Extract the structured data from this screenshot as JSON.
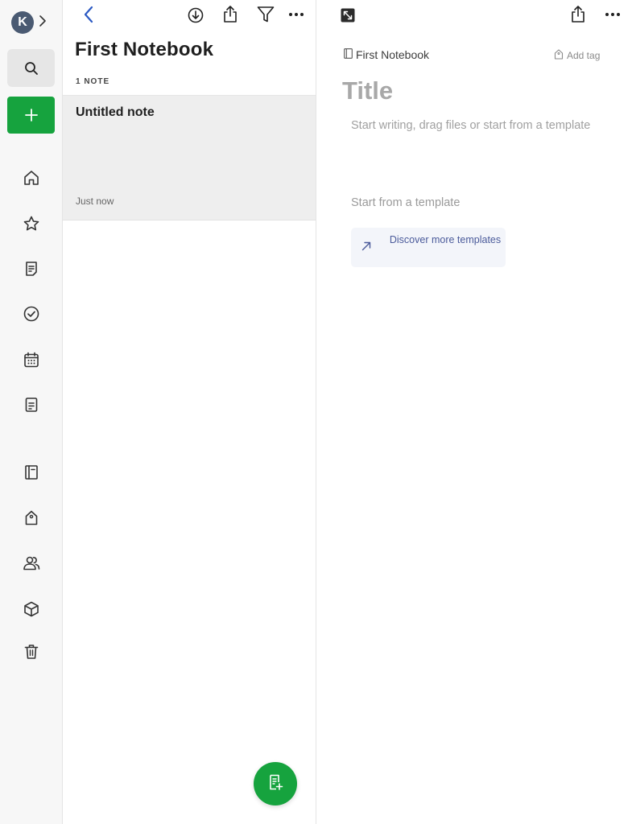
{
  "sidebar": {
    "avatar_initial": "K",
    "items": [
      {
        "name": "home-icon"
      },
      {
        "name": "star-icon"
      },
      {
        "name": "notes-icon"
      },
      {
        "name": "tasks-icon"
      },
      {
        "name": "calendar-icon"
      },
      {
        "name": "templates-icon"
      },
      {
        "name": "notebook-icon"
      },
      {
        "name": "tag-icon"
      },
      {
        "name": "shared-icon"
      },
      {
        "name": "spaces-icon"
      },
      {
        "name": "trash-icon"
      }
    ]
  },
  "list": {
    "notebook_title": "First Notebook",
    "note_count": "1 NOTE",
    "notes": [
      {
        "title": "Untitled note",
        "time": "Just now"
      }
    ]
  },
  "editor": {
    "breadcrumb": "First Notebook",
    "add_tag": "Add tag",
    "title_placeholder": "Title",
    "body_placeholder": "Start writing, drag files or start from a template",
    "template_heading": "Start from a template",
    "discover_label": "Discover more templates"
  },
  "colors": {
    "accent_green": "#16a33e",
    "back_blue": "#2b59c3",
    "template_text": "#4a5a9a"
  }
}
